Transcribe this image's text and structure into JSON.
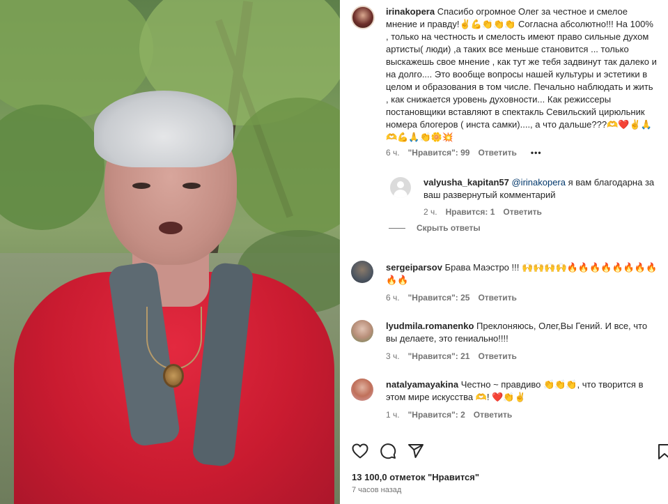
{
  "post": {
    "author": "irinakopera",
    "text": "Спасибо огромное Олег за честное и смелое мнение и правду!✌️💪👏👏👏 Согласна абсолютно!!! На 100% , только на честность и смелость имеют право сильные духом артисты( люди) ,а таких все меньше становится ... только выскажешь свое мнение , как тут же тебя задвинут так далеко и на долго.... Это вообще вопросы нашей культуры и эстетики в целом и образования в том числе. Печально наблюдать и жить , как снижается уровень духовности... Как режиссеры постановщики вставляют в спектакль Севильский цирюльник номера блогеров ( инста самки)...., а что дальше???🫶❤️✌️🙏🫶💪🙏👏🌼💥",
    "time": "6 ч.",
    "likes": "\"Нравится\": 99",
    "reply_label": "Ответить",
    "more": "•••"
  },
  "replies": [
    {
      "author": "valyusha_kapitan57",
      "mention": "@irinakopera",
      "text": " я вам благодарна за ваш развернутый комментарий",
      "time": "2 ч.",
      "likes": "Нравится: 1",
      "reply_label": "Ответить"
    }
  ],
  "hide_replies": "Скрыть ответы",
  "comments": [
    {
      "author": "sergeiparsov",
      "text": "Брава Маэстро !!! 🙌🙌🙌🙌🔥🔥🔥🔥🔥🔥🔥🔥🔥🔥",
      "time": "6 ч.",
      "likes": "\"Нравится\": 25",
      "reply_label": "Ответить"
    },
    {
      "author": "lyudmila.romanenko",
      "text": "Преклоняюсь, Олег,Вы Гений. И все, что вы делаете, это гениально!!!!",
      "time": "3 ч.",
      "likes": "\"Нравится\": 21",
      "reply_label": "Ответить"
    },
    {
      "author": "natalyamayakina",
      "text": "Честно ~ правдиво 👏👏👏, что творится в этом мире искусства 🫶! ❤️👏✌️",
      "time": "1 ч.",
      "likes": "\"Нравится\": 2",
      "reply_label": "Ответить"
    }
  ],
  "footer": {
    "likes_count": "13 100,0 отметок \"Нравится\"",
    "posted": "7 часов назад"
  },
  "icons": {
    "like": "heart-icon",
    "comment": "comment-icon",
    "share": "share-icon",
    "save": "bookmark-icon"
  }
}
